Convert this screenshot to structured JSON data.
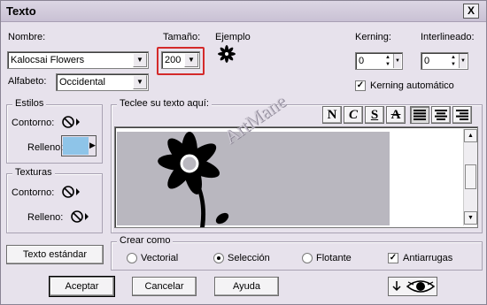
{
  "window": {
    "title": "Texto",
    "close_glyph": "X"
  },
  "font": {
    "name_label": "Nombre:",
    "name_value": "Kalocsai Flowers",
    "alphabet_label": "Alfabeto:",
    "alphabet_value": "Occidental",
    "size_label": "Tamaño:",
    "size_value": "200",
    "size_highlight_color": "#d42a2a",
    "example_label": "Ejemplo"
  },
  "spacing": {
    "kerning_label": "Kerning:",
    "kerning_value": "0",
    "leading_label": "Interlineado:",
    "leading_value": "0",
    "auto_kerning_label": "Kerning automático",
    "auto_kerning_checked": true
  },
  "styles": {
    "title": "Estilos",
    "outline_label": "Contorno:",
    "fill_label": "Relleno:",
    "fill_color": "#8ec4e8"
  },
  "textures": {
    "title": "Texturas",
    "outline_label": "Contorno:",
    "fill_label": "Relleno:"
  },
  "editor": {
    "label": "Teclee su texto aquí:",
    "watermark": "ArtMane",
    "format_buttons": [
      "N",
      "C",
      "S",
      "A"
    ],
    "align_icons": [
      "align-left-icon",
      "align-center-icon",
      "align-right-icon"
    ]
  },
  "create_as": {
    "title": "Crear como",
    "options": [
      "Vectorial",
      "Selección",
      "Flotante"
    ],
    "selected_index": 1,
    "antialias_label": "Antiarrugas",
    "antialias_checked": true
  },
  "buttons": {
    "standard_text": "Texto estándar",
    "ok": "Aceptar",
    "cancel": "Cancelar",
    "help": "Ayuda"
  }
}
